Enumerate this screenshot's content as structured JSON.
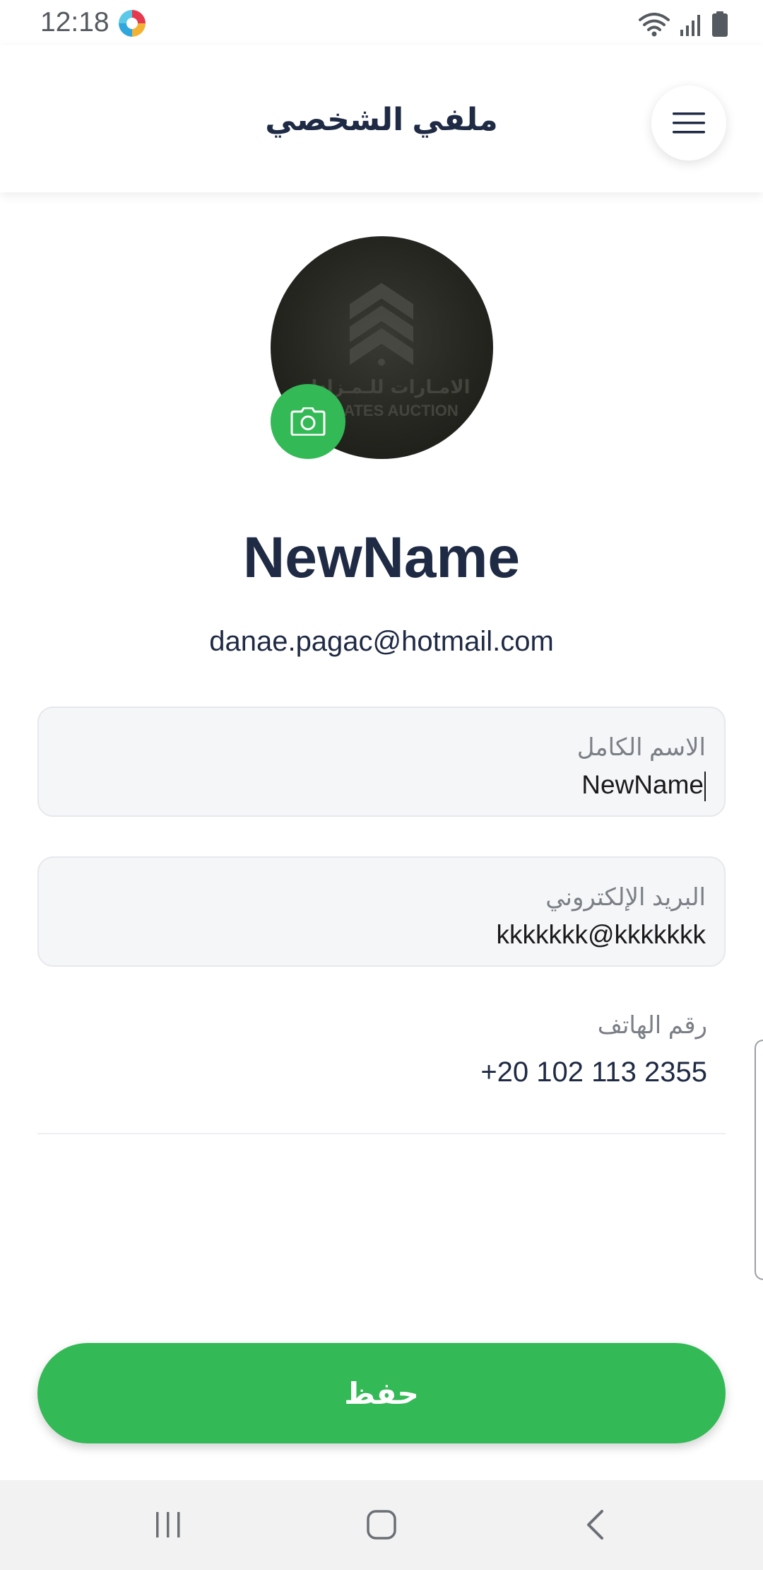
{
  "status_bar": {
    "time": "12:18"
  },
  "header": {
    "title": "ملفي الشخصي",
    "menu_icon": "hamburger-menu-icon"
  },
  "profile": {
    "avatar_icon": "emirates-auction-logo",
    "camera_icon": "camera-icon",
    "name": "NewName",
    "email": "danae.pagac@hotmail.com"
  },
  "form": {
    "full_name": {
      "label": "الاسم الكامل",
      "value": "NewName"
    },
    "email": {
      "label": "البريد الإلكتروني",
      "value": "kkkkkkk@kkkkkkk"
    },
    "phone": {
      "label": "رقم الهاتف",
      "value": "+20 102 113 2355"
    }
  },
  "save_button": {
    "label": "حفظ"
  },
  "colors": {
    "accent": "#33b955",
    "text_dark": "#1f2a44",
    "label_gray": "#7b7f86"
  },
  "nav": {
    "recents_icon": "recents-icon",
    "home_icon": "home-icon",
    "back_icon": "back-icon"
  }
}
